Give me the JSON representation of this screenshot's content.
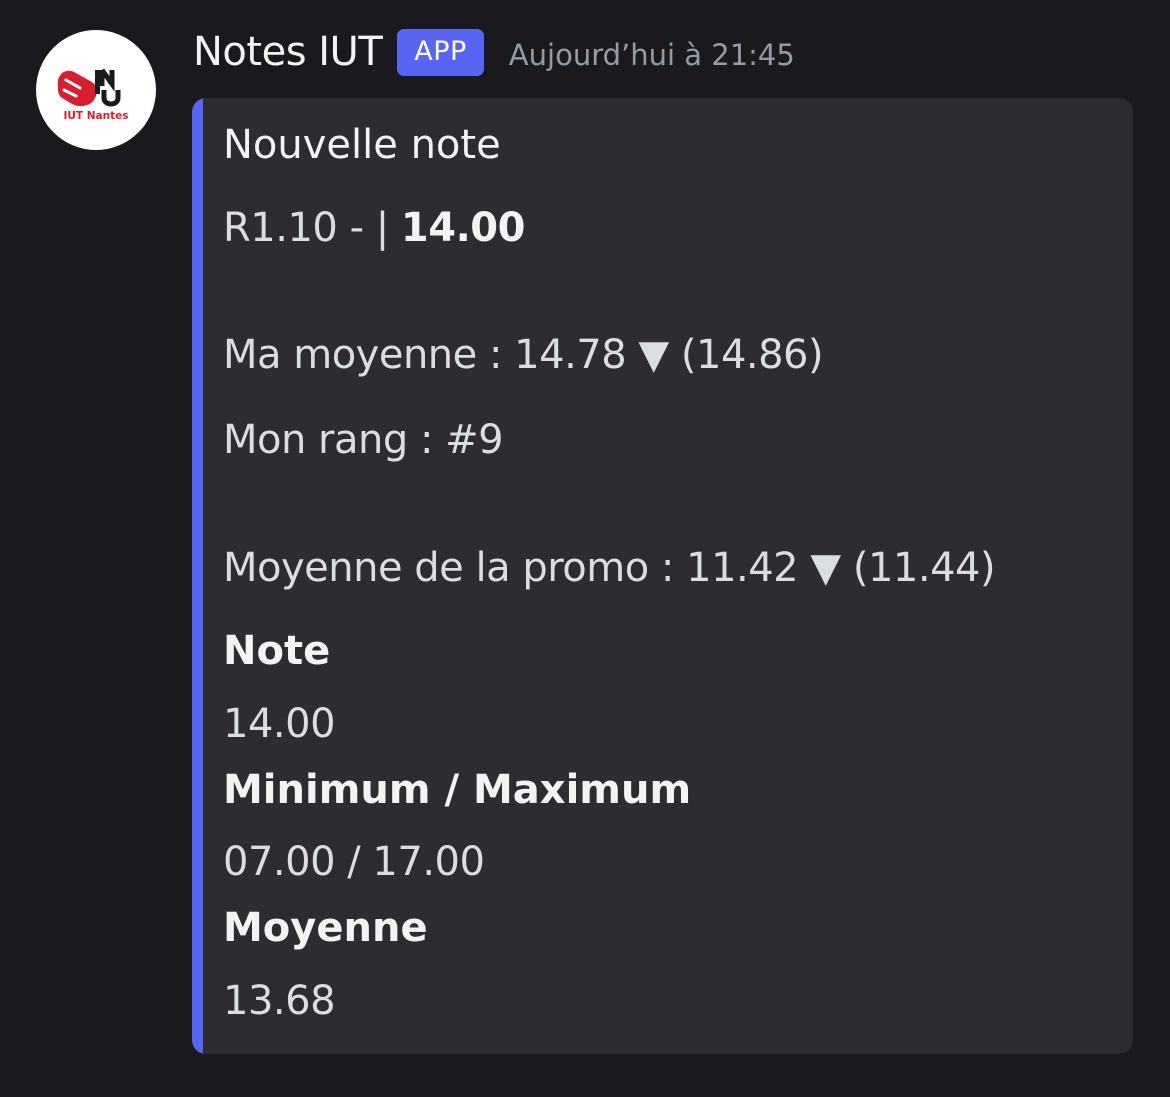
{
  "message": {
    "avatar": {
      "icon": "iut-nantes-logo",
      "caption": "IUT Nantes",
      "brand_color": "#d7202f"
    },
    "author": "Notes IUT",
    "badge": "APP",
    "timestamp": "Aujourd’hui à 21:45",
    "accent_color": "#5865f2"
  },
  "embed": {
    "title": "Nouvelle note",
    "subject_prefix": "R1.10 -  |",
    "subject_grade": "14.00",
    "my_average": {
      "label": "Ma moyenne : 14.78",
      "arrow": "▼",
      "previous": "(14.86)"
    },
    "rank": "Mon rang : #9",
    "class_average": {
      "label": "Moyenne de la promo : 11.42",
      "arrow": "▼",
      "previous": "(11.44)"
    },
    "fields": [
      {
        "name": "Note",
        "value": "14.00"
      },
      {
        "name": "Minimum / Maximum",
        "value": "07.00 / 17.00"
      },
      {
        "name": "Moyenne",
        "value": "13.68"
      }
    ]
  }
}
